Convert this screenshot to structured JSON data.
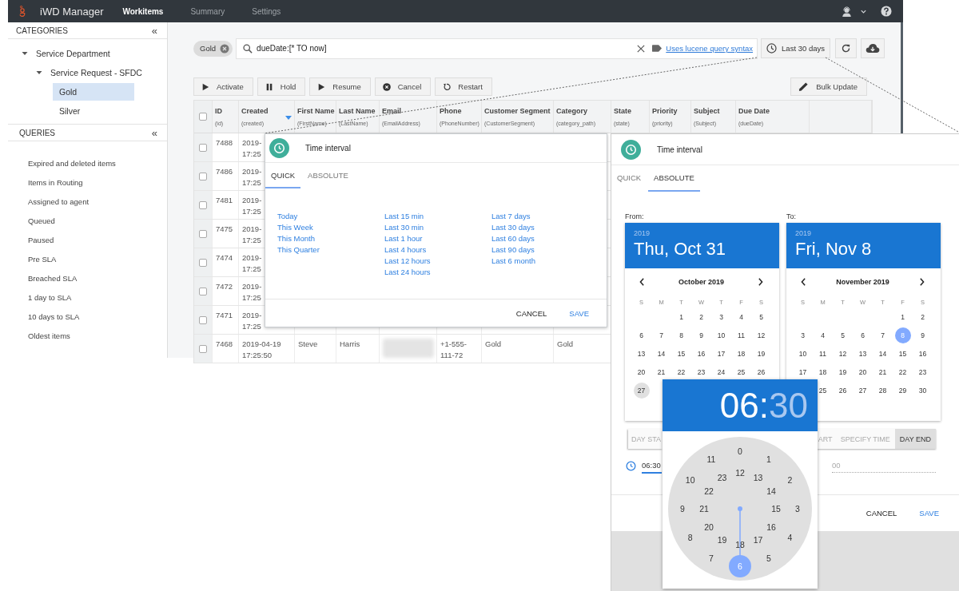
{
  "app": {
    "title": "iWD Manager"
  },
  "nav_tabs": [
    {
      "label": "Workitems",
      "selected": true
    },
    {
      "label": "Summary",
      "selected": false
    },
    {
      "label": "Settings",
      "selected": false
    }
  ],
  "sidebar": {
    "categories": {
      "title": "CATEGORIES",
      "collapse": "«",
      "tree": [
        {
          "label": "Service Department",
          "expanded": true,
          "selected": false,
          "children": [
            {
              "label": "Service Request - SFDC",
              "expanded": true,
              "selected": false,
              "children": [
                {
                  "label": "Gold",
                  "selected": true
                },
                {
                  "label": "Silver",
                  "selected": false
                }
              ]
            }
          ]
        }
      ]
    },
    "queries": {
      "title": "QUERIES",
      "collapse": "«",
      "items": [
        "Expired and deleted items",
        "Items in Routing",
        "Assigned to agent",
        "Queued",
        "Paused",
        "Pre SLA",
        "Breached SLA",
        "1 day to SLA",
        "10 days to SLA",
        "Oldest items"
      ]
    }
  },
  "filter": {
    "chip": "Gold",
    "query": "dueDate:[* TO now]",
    "syntax_link": "Uses lucene query syntax",
    "range_button": "Last 30 days"
  },
  "toolbar": {
    "actions": [
      {
        "label": "Activate",
        "kind": "play"
      },
      {
        "label": "Hold",
        "kind": "pause"
      },
      {
        "label": "Resume",
        "kind": "play"
      },
      {
        "label": "Cancel",
        "kind": "cancel"
      },
      {
        "label": "Restart",
        "kind": "restart"
      }
    ],
    "bulk_update": "Bulk Update"
  },
  "table": {
    "select_all_checked": false,
    "columns": [
      {
        "title": "ID",
        "field": "(id)",
        "sorted": false
      },
      {
        "title": "Created",
        "field": "(created)",
        "sorted": true
      },
      {
        "title": "First Name",
        "field": "(FirstName)",
        "sorted": false
      },
      {
        "title": "Last Name",
        "field": "(LastName)",
        "sorted": false
      },
      {
        "title": "Email",
        "field": "(EmailAddress)",
        "sorted": false
      },
      {
        "title": "Phone",
        "field": "(PhoneNumber)",
        "sorted": false
      },
      {
        "title": "Customer Segment",
        "field": "(CustomerSegment)",
        "sorted": false
      },
      {
        "title": "Category",
        "field": "(category_path)",
        "sorted": false
      },
      {
        "title": "State",
        "field": "(state)",
        "sorted": false
      },
      {
        "title": "Priority",
        "field": "(priority)",
        "sorted": false
      },
      {
        "title": "Subject",
        "field": "(Subject)",
        "sorted": false
      },
      {
        "title": "Due Date",
        "field": "(dueDate)",
        "sorted": false
      }
    ],
    "rows": [
      {
        "checked": false,
        "cells": [
          [
            "7488"
          ],
          [
            "2019-",
            "17:25"
          ]
        ]
      },
      {
        "checked": false,
        "cells": [
          [
            "7486"
          ],
          [
            "2019-",
            "17:25"
          ]
        ]
      },
      {
        "checked": false,
        "cells": [
          [
            "7481"
          ],
          [
            "2019-",
            "17:25"
          ]
        ]
      },
      {
        "checked": false,
        "cells": [
          [
            "7475"
          ],
          [
            "2019-",
            "17:25"
          ]
        ]
      },
      {
        "checked": false,
        "cells": [
          [
            "7474"
          ],
          [
            "2019-",
            "17:25"
          ]
        ]
      },
      {
        "checked": false,
        "cells": [
          [
            "7472"
          ],
          [
            "2019-",
            "17:25"
          ]
        ]
      },
      {
        "checked": false,
        "cells": [
          [
            "7471"
          ],
          [
            "2019-",
            "17:25"
          ]
        ]
      },
      {
        "checked": false,
        "cells": [
          [
            "7468"
          ],
          [
            "2019-04-19",
            "17:25:50"
          ],
          [
            "Steve"
          ],
          [
            "Harris"
          ],
          {
            "kind": "blurred"
          },
          [
            "+1-555-",
            "111-72"
          ],
          [
            "Gold"
          ],
          [
            "Gold"
          ]
        ]
      }
    ]
  },
  "quick_dialog": {
    "title": "Time interval",
    "tabs": [
      {
        "label": "QUICK",
        "selected": true
      },
      {
        "label": "ABSOLUTE",
        "selected": false
      }
    ],
    "ranges": [
      [
        "Today",
        "This Week",
        "This Month",
        "This Quarter"
      ],
      [
        "Last 15 min",
        "Last 30 min",
        "Last 1 hour",
        "Last 4 hours",
        "Last 12 hours",
        "Last 24 hours"
      ],
      [
        "Last 7 days",
        "Last 30 days",
        "Last 60 days",
        "Last 90 days",
        "Last 6 month"
      ]
    ],
    "actions": [
      {
        "label": "CANCEL",
        "kind": "neutral"
      },
      {
        "label": "SAVE",
        "kind": "primary"
      }
    ]
  },
  "absolute_dialog": {
    "title": "Time interval",
    "tabs": [
      {
        "label": "QUICK",
        "selected": false
      },
      {
        "label": "ABSOLUTE",
        "selected": true
      }
    ],
    "calendars": [
      {
        "label": "From:",
        "year": "2019",
        "date": "Thu, Oct 31",
        "month": "October 2019",
        "weekdays": [
          "S",
          "M",
          "T",
          "W",
          "T",
          "F",
          "S"
        ],
        "weeks": [
          {
            "kind": "leading",
            "days": [
              {
                "day": "1",
                "selected": false
              },
              {
                "day": "2",
                "selected": false
              },
              {
                "day": "3",
                "selected": false
              },
              {
                "day": "4",
                "selected": false
              },
              {
                "day": "5",
                "selected": false
              }
            ]
          },
          {
            "days": [
              {
                "day": "6",
                "selected": false
              },
              {
                "day": "7",
                "selected": false
              },
              {
                "day": "8",
                "selected": false
              },
              {
                "day": "9",
                "selected": false
              },
              {
                "day": "10",
                "selected": false
              },
              {
                "day": "11",
                "selected": false
              },
              {
                "day": "12",
                "selected": false
              }
            ]
          },
          {
            "days": [
              {
                "day": "13",
                "selected": false
              },
              {
                "day": "14",
                "selected": false
              },
              {
                "day": "15",
                "selected": false
              },
              {
                "day": "16",
                "selected": false
              },
              {
                "day": "17",
                "selected": false
              },
              {
                "day": "18",
                "selected": false
              },
              {
                "day": "19",
                "selected": false
              }
            ]
          },
          {
            "days": [
              {
                "day": "20",
                "selected": false
              },
              {
                "day": "21",
                "selected": false
              },
              {
                "day": "22",
                "selected": false
              },
              {
                "day": "23",
                "selected": false
              },
              {
                "day": "24",
                "selected": false
              },
              {
                "day": "25",
                "selected": false
              },
              {
                "day": "26",
                "selected": false
              }
            ]
          },
          {
            "kind": "trailing",
            "days": [
              {
                "day": "27",
                "selected": false,
                "hovered": true
              }
            ]
          }
        ]
      },
      {
        "label": "To:",
        "year": "2019",
        "date": "Fri, Nov 8",
        "month": "November 2019",
        "weekdays": [
          "S",
          "M",
          "T",
          "W",
          "T",
          "F",
          "S"
        ],
        "weeks": [
          {
            "kind": "leading",
            "days": [
              {
                "day": "1",
                "selected": false
              },
              {
                "day": "2",
                "selected": false
              }
            ]
          },
          {
            "days": [
              {
                "day": "3",
                "selected": false
              },
              {
                "day": "4",
                "selected": false
              },
              {
                "day": "5",
                "selected": false
              },
              {
                "day": "6",
                "selected": false
              },
              {
                "day": "7",
                "selected": false
              },
              {
                "day": "8",
                "selected": true
              },
              {
                "day": "9",
                "selected": false
              }
            ]
          },
          {
            "days": [
              {
                "day": "10",
                "selected": false
              },
              {
                "day": "11",
                "selected": false
              },
              {
                "day": "12",
                "selected": false
              },
              {
                "day": "13",
                "selected": false
              },
              {
                "day": "14",
                "selected": false
              },
              {
                "day": "15",
                "selected": false
              },
              {
                "day": "16",
                "selected": false
              }
            ]
          },
          {
            "days": [
              {
                "day": "17",
                "selected": false
              },
              {
                "day": "18",
                "selected": false
              },
              {
                "day": "19",
                "selected": false
              },
              {
                "day": "20",
                "selected": false
              },
              {
                "day": "21",
                "selected": false
              },
              {
                "day": "22",
                "selected": false
              },
              {
                "day": "23",
                "selected": false
              }
            ]
          },
          {
            "kind": "leading",
            "days": [
              {
                "day": "25",
                "selected": false
              },
              {
                "day": "26",
                "selected": false
              },
              {
                "day": "27",
                "selected": false
              },
              {
                "day": "28",
                "selected": false
              },
              {
                "day": "29",
                "selected": false
              },
              {
                "day": "30",
                "selected": false
              }
            ]
          }
        ]
      }
    ],
    "from_modes": [
      {
        "label": "DAY STA",
        "selected": false
      }
    ],
    "to_modes": [
      {
        "label": "ART",
        "selected": false
      },
      {
        "label": "SPECIFY TIME",
        "selected": false
      },
      {
        "label": "DAY END",
        "selected": true
      }
    ],
    "from_time": "06:30",
    "to_time": "00",
    "actions": [
      {
        "label": "CANCEL",
        "kind": "neutral"
      },
      {
        "label": "SAVE",
        "kind": "primary"
      }
    ]
  },
  "time_picker": {
    "hours": "06",
    "separator": ":",
    "minutes": "30",
    "hours_active": true,
    "outer": [
      {
        "label": "0",
        "selected": false
      },
      {
        "label": "1",
        "selected": false
      },
      {
        "label": "2",
        "selected": false
      },
      {
        "label": "3",
        "selected": false
      },
      {
        "label": "4",
        "selected": false
      },
      {
        "label": "5",
        "selected": false
      },
      {
        "label": "6",
        "selected": true
      },
      {
        "label": "7",
        "selected": false
      },
      {
        "label": "8",
        "selected": false
      },
      {
        "label": "9",
        "selected": false
      },
      {
        "label": "10",
        "selected": false
      },
      {
        "label": "11",
        "selected": false
      }
    ],
    "inner": [
      {
        "label": "12",
        "selected": false
      },
      {
        "label": "13",
        "selected": false
      },
      {
        "label": "14",
        "selected": false
      },
      {
        "label": "15",
        "selected": false
      },
      {
        "label": "16",
        "selected": false
      },
      {
        "label": "17",
        "selected": false
      },
      {
        "label": "18",
        "selected": false
      },
      {
        "label": "19",
        "selected": false
      },
      {
        "label": "20",
        "selected": false
      },
      {
        "label": "21",
        "selected": false
      },
      {
        "label": "22",
        "selected": false
      },
      {
        "label": "23",
        "selected": false
      }
    ]
  }
}
